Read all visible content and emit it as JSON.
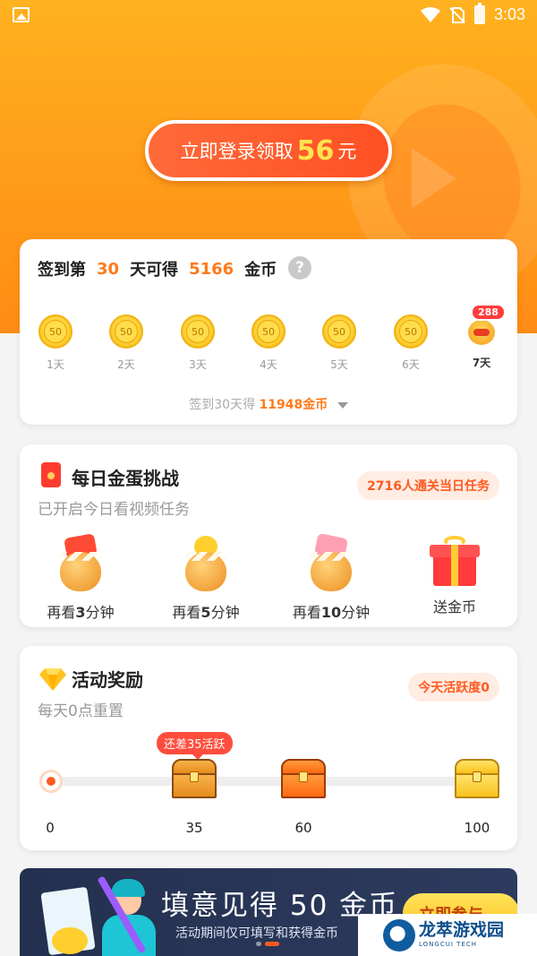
{
  "status_bar": {
    "time": "3:03"
  },
  "hero": {
    "login_prefix": "立即登录领取",
    "login_amount": "56",
    "login_suffix": "元"
  },
  "signin": {
    "title_prefix": "签到第",
    "day_count": "30",
    "title_mid": "天可得",
    "coin_count": "5166",
    "title_suffix": "金币",
    "help_label": "?",
    "days": [
      {
        "coin": "50",
        "label": "1天"
      },
      {
        "coin": "50",
        "label": "2天"
      },
      {
        "coin": "50",
        "label": "3天"
      },
      {
        "coin": "50",
        "label": "4天"
      },
      {
        "coin": "50",
        "label": "5天"
      },
      {
        "coin": "50",
        "label": "6天"
      },
      {
        "badge": "288",
        "label": "7天"
      }
    ],
    "footer_prefix": "签到30天得",
    "footer_amount": "11948金币"
  },
  "egg_challenge": {
    "title": "每日金蛋挑战",
    "subtitle": "已开启今日看视频任务",
    "pill_count": "2716",
    "pill_text": "人通关当日任务",
    "items": [
      {
        "prefix": "再看",
        "num": "3",
        "suffix": "分钟"
      },
      {
        "prefix": "再看",
        "num": "5",
        "suffix": "分钟"
      },
      {
        "prefix": "再看",
        "num": "10",
        "suffix": "分钟"
      },
      {
        "prefix": "送金币",
        "num": "",
        "suffix": ""
      }
    ]
  },
  "activity": {
    "title": "活动奖励",
    "subtitle": "每天0点重置",
    "pill_text": "今天活跃度0",
    "tip": "还差35活跃",
    "milestones": [
      "0",
      "35",
      "60",
      "100"
    ],
    "progress": 0
  },
  "banner": {
    "title": "填意见得 50 金币",
    "subtitle": "活动期间仅可填写和获得金币",
    "button": "立即参与"
  },
  "watermark": {
    "name_cn": "龙萃游戏园",
    "name_en": "LONGCUI TECH"
  },
  "colors": {
    "accent": "#ff7a1a",
    "hero": "#ff9f1a",
    "pill_bg": "#ffece3"
  }
}
